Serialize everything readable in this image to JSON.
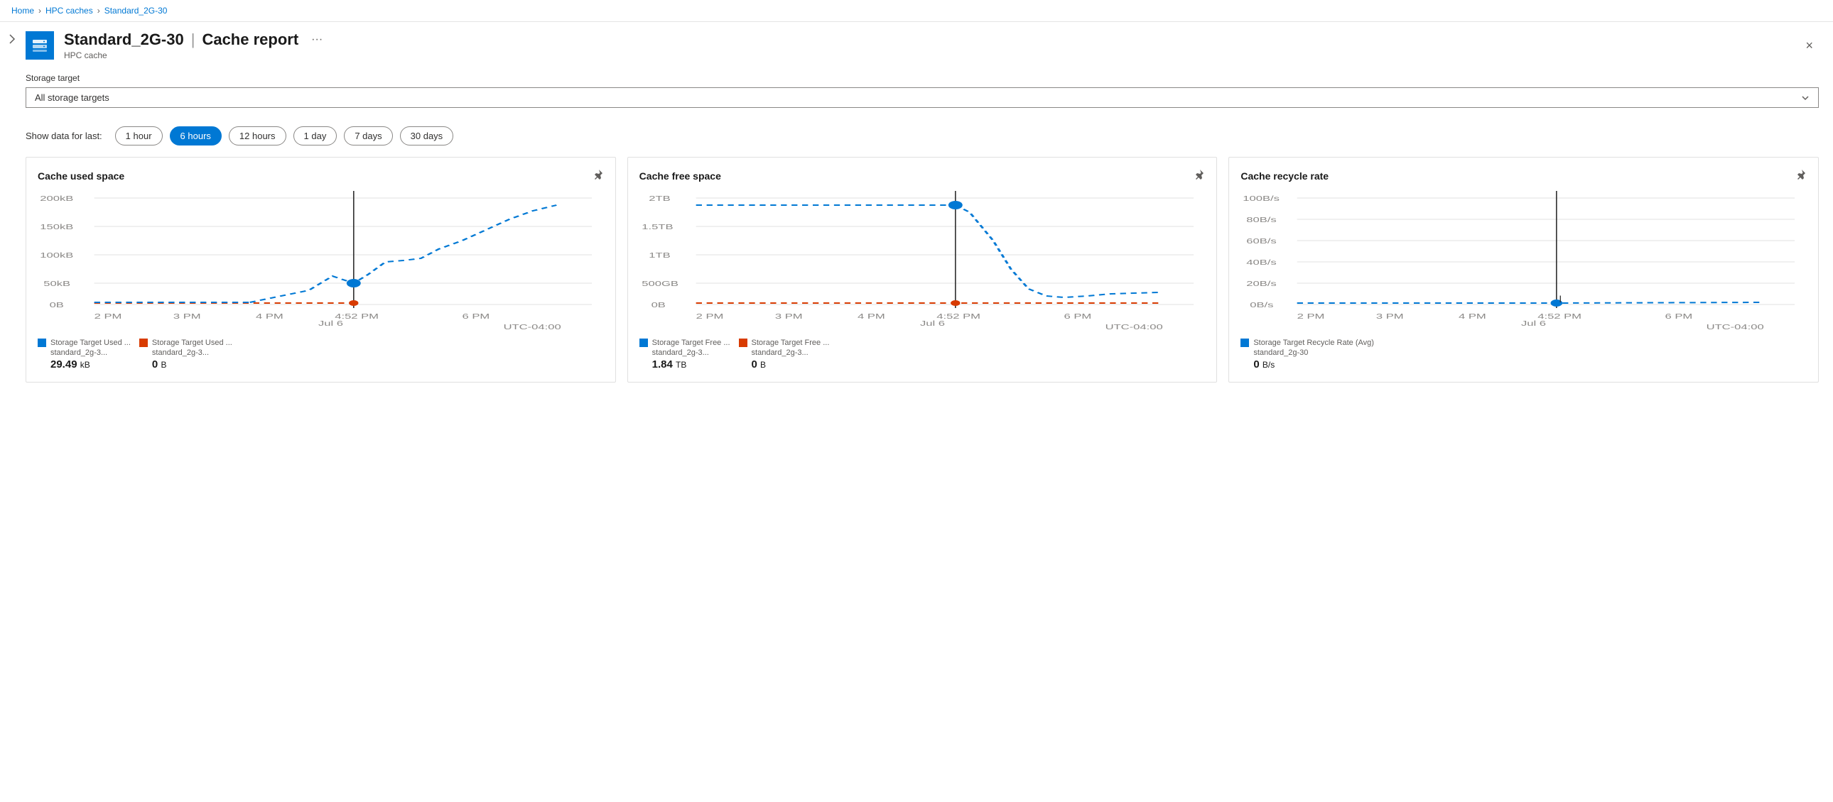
{
  "breadcrumb": {
    "home": "Home",
    "hpcCaches": "HPC caches",
    "current": "Standard_2G-30"
  },
  "header": {
    "icon_label": "hpc-cache-icon",
    "title": "Standard_2G-30",
    "separator": "|",
    "subtitle_text": "Cache report",
    "resource_type": "HPC cache",
    "more_label": "···",
    "close_label": "×"
  },
  "storage_target": {
    "label": "Storage target",
    "selected": "All storage targets",
    "options": [
      "All storage targets",
      "standard_2g-30"
    ]
  },
  "time_filter": {
    "label": "Show data for last:",
    "options": [
      {
        "label": "1 hour",
        "active": false
      },
      {
        "label": "6 hours",
        "active": true
      },
      {
        "label": "12 hours",
        "active": false
      },
      {
        "label": "1 day",
        "active": false
      },
      {
        "label": "7 days",
        "active": false
      },
      {
        "label": "30 days",
        "active": false
      }
    ]
  },
  "charts": [
    {
      "id": "cache-used-space",
      "title": "Cache used space",
      "pin_label": "pin",
      "y_axis": [
        "200kB",
        "150kB",
        "100kB",
        "50kB",
        "0B"
      ],
      "x_axis": [
        "2 PM",
        "3 PM",
        "4 PM",
        "Jul 6",
        "4:52 PM",
        "6 PM",
        "UTC-04:00"
      ],
      "legend": [
        {
          "color": "#0078d4",
          "label": "Storage Target Used ...",
          "sublabel": "standard_2g-3...",
          "value": "29.49",
          "unit": "kB"
        },
        {
          "color": "#d83b01",
          "label": "Storage Target Used ...",
          "sublabel": "standard_2g-3...",
          "value": "0",
          "unit": "B"
        }
      ]
    },
    {
      "id": "cache-free-space",
      "title": "Cache free space",
      "pin_label": "pin",
      "y_axis": [
        "2TB",
        "1.5TB",
        "1TB",
        "500GB",
        "0B"
      ],
      "x_axis": [
        "2 PM",
        "3 PM",
        "4 PM",
        "Jul 6",
        "4:52 PM",
        "6 PM",
        "UTC-04:00"
      ],
      "legend": [
        {
          "color": "#0078d4",
          "label": "Storage Target Free ...",
          "sublabel": "standard_2g-3...",
          "value": "1.84",
          "unit": "TB"
        },
        {
          "color": "#d83b01",
          "label": "Storage Target Free ...",
          "sublabel": "standard_2g-3...",
          "value": "0",
          "unit": "B"
        }
      ]
    },
    {
      "id": "cache-recycle-rate",
      "title": "Cache recycle rate",
      "pin_label": "pin",
      "y_axis": [
        "100B/s",
        "80B/s",
        "60B/s",
        "40B/s",
        "20B/s",
        "0B/s"
      ],
      "x_axis": [
        "2 PM",
        "3 PM",
        "4 PM",
        "Jul 6",
        "4:52 PM",
        "6 PM",
        "UTC-04:00"
      ],
      "legend": [
        {
          "color": "#0078d4",
          "label": "Storage Target Recycle Rate (Avg)",
          "sublabel": "standard_2g-30",
          "value": "0",
          "unit": "B/s"
        }
      ]
    }
  ]
}
